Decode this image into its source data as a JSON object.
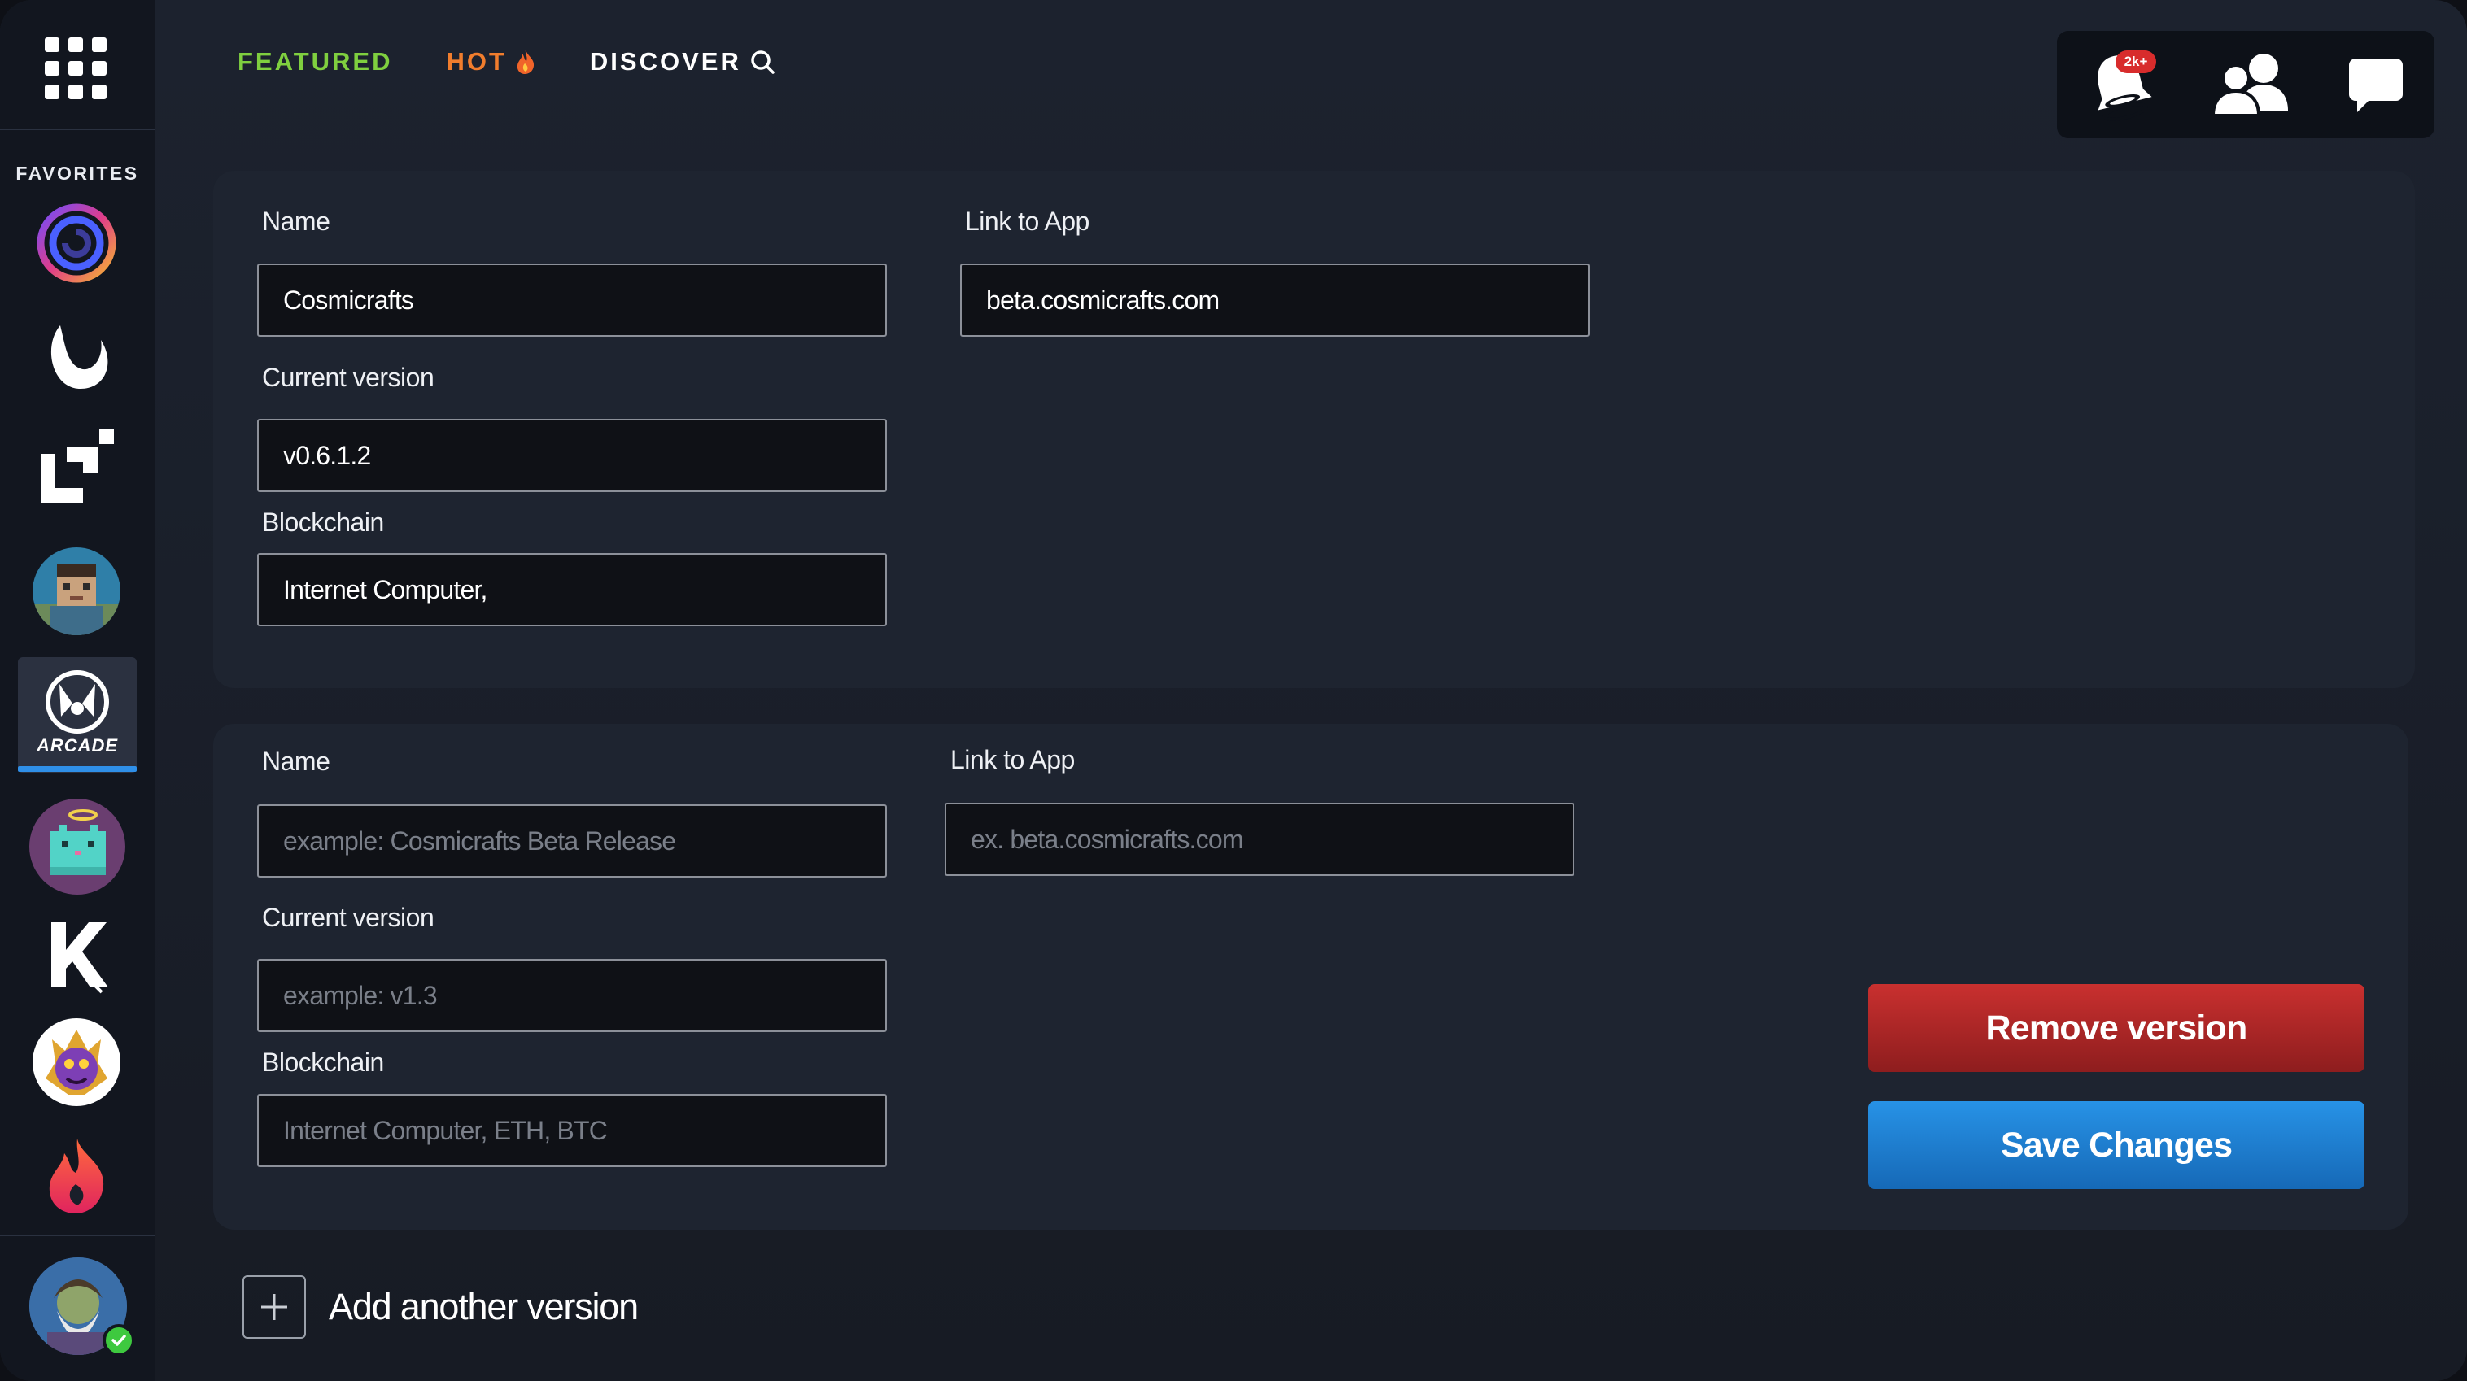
{
  "sidebar": {
    "favorites_label": "FAVORITES",
    "items": [
      {
        "name": "cosmicrafts",
        "icon": "spiral-logo-icon"
      },
      {
        "name": "crescent",
        "icon": "crescent-logo-icon"
      },
      {
        "name": "corner",
        "icon": "corner-logo-icon"
      },
      {
        "name": "blocky-avatar",
        "icon": "blocky-avatar-icon"
      },
      {
        "name": "arcade",
        "icon": "arcade-logo-icon",
        "label": "ARCADE",
        "active": true
      },
      {
        "name": "pixel-cat",
        "icon": "pixel-cat-icon"
      },
      {
        "name": "k-app",
        "icon": "k-logo-icon"
      },
      {
        "name": "monster",
        "icon": "monster-avatar-icon"
      },
      {
        "name": "flame",
        "icon": "flame-logo-icon"
      }
    ],
    "user": {
      "icon": "user-avatar-icon",
      "status": "online"
    }
  },
  "topnav": {
    "featured": "FEATURED",
    "hot": "HOT",
    "discover": "DISCOVER"
  },
  "topright": {
    "notifications_badge": "2k+",
    "icons": [
      "notification-bell-icon",
      "friends-icon",
      "chat-icon"
    ]
  },
  "version1": {
    "name_label": "Name",
    "name_value": "Cosmicrafts",
    "link_label": "Link to App",
    "link_value": "beta.cosmicrafts.com",
    "version_label": "Current version",
    "version_value": "v0.6.1.2",
    "blockchain_label": "Blockchain",
    "blockchain_value": "Internet Computer,"
  },
  "version2": {
    "name_label": "Name",
    "name_placeholder": "example: Cosmicrafts Beta Release",
    "link_label": "Link to App",
    "link_placeholder": "ex. beta.cosmicrafts.com",
    "version_label": "Current version",
    "version_placeholder": "example: v1.3",
    "blockchain_label": "Blockchain",
    "blockchain_placeholder": "Internet Computer, ETH, BTC"
  },
  "actions": {
    "remove": "Remove version",
    "save": "Save Changes",
    "add": "Add another version"
  },
  "colors": {
    "featured": "#7fcf3f",
    "hot": "#f07d2d",
    "remove": "#b32828",
    "save": "#1f82d6",
    "active_indicator": "#2f8fe8"
  }
}
